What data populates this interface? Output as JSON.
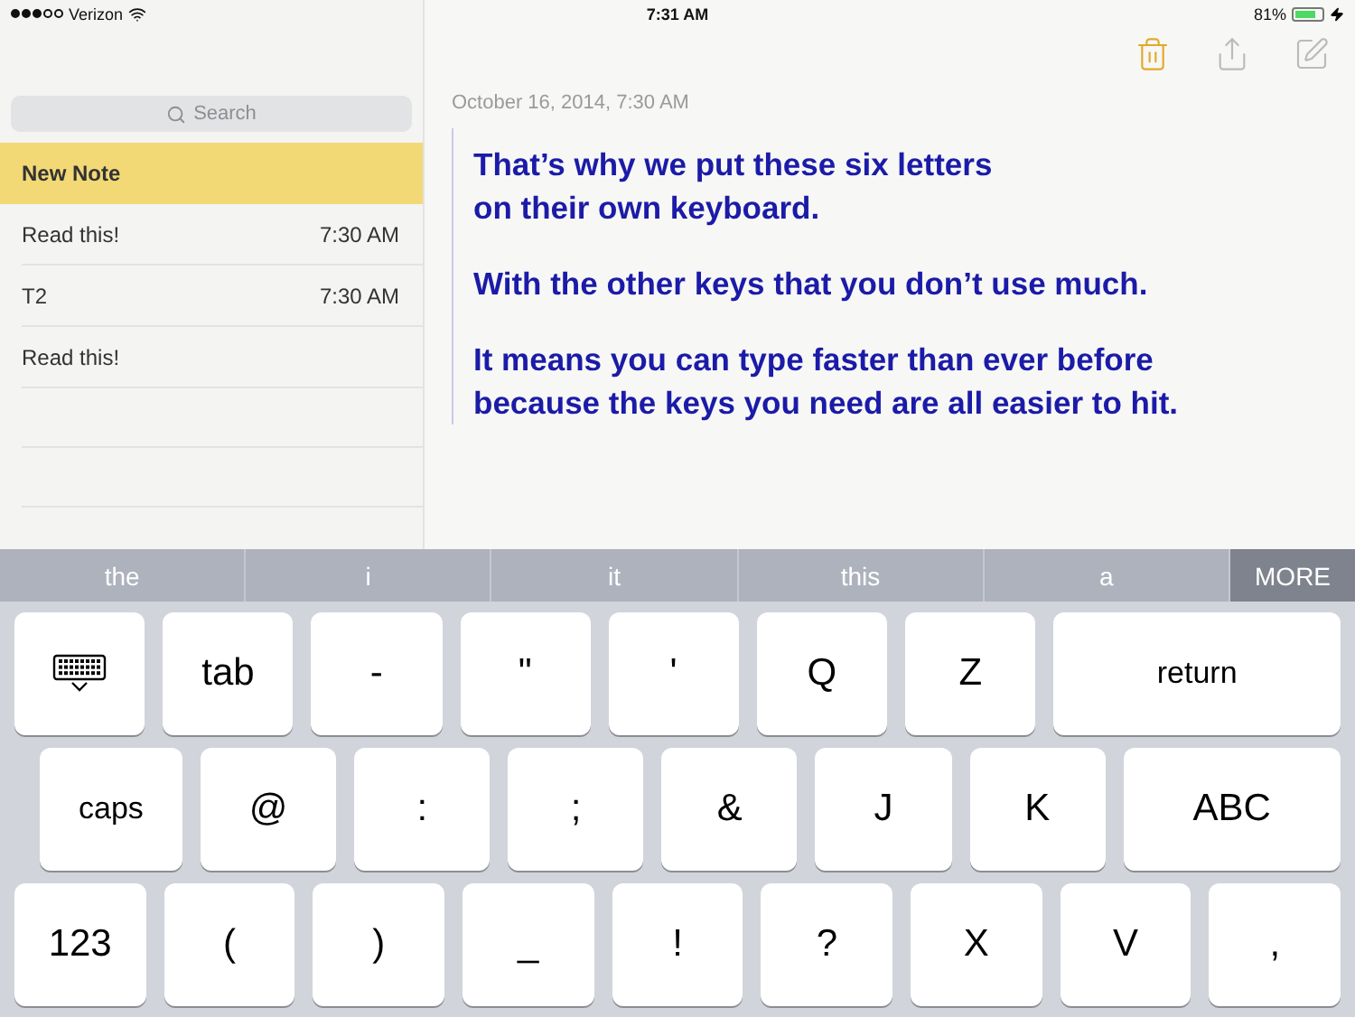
{
  "status_bar": {
    "carrier": "Verizon",
    "time": "7:31 AM",
    "battery": "81%"
  },
  "sidebar": {
    "search": {
      "placeholder": "Search"
    },
    "notes": [
      {
        "title": "New Note",
        "selected": true
      },
      {
        "title": "Read this!",
        "time": "7:30 AM",
        "selected": false
      },
      {
        "title": "T2",
        "time": "7:30 AM",
        "selected": false
      },
      {
        "title": "Read this!",
        "selected": false
      }
    ]
  },
  "note": {
    "date": "October 16, 2014, 7:30 AM",
    "paragraphs": [
      "That’s why we put these six letters\non their own keyboard.",
      "With the other keys that you don’t use much.",
      "It means you can type faster than ever before\nbecause the keys you need are all easier to hit."
    ]
  },
  "suggestions": [
    {
      "label": "the",
      "kind": "word"
    },
    {
      "label": "i",
      "kind": "word"
    },
    {
      "label": "it",
      "kind": "word"
    },
    {
      "label": "this",
      "kind": "word"
    },
    {
      "label": "a",
      "kind": "word"
    },
    {
      "label": "MORE",
      "kind": "more"
    }
  ],
  "keyboard": [
    [
      {
        "kind": "dismiss"
      },
      {
        "label": "tab",
        "kind": "key"
      },
      {
        "label": "-",
        "kind": "key"
      },
      {
        "label": "\"",
        "kind": "key"
      },
      {
        "label": "'",
        "kind": "key"
      },
      {
        "label": "Q",
        "kind": "key"
      },
      {
        "label": "Z",
        "kind": "key"
      },
      {
        "label": "return",
        "kind": "return"
      }
    ],
    [
      {
        "label": "caps",
        "kind": "caps"
      },
      {
        "label": "@",
        "kind": "key"
      },
      {
        "label": ":",
        "kind": "key"
      },
      {
        "label": ";",
        "kind": "key"
      },
      {
        "label": "&",
        "kind": "key"
      },
      {
        "label": "J",
        "kind": "key"
      },
      {
        "label": "K",
        "kind": "key"
      },
      {
        "label": "ABC",
        "kind": "abc"
      }
    ],
    [
      {
        "label": "123",
        "kind": "key"
      },
      {
        "label": "(",
        "kind": "key"
      },
      {
        "label": ")",
        "kind": "key"
      },
      {
        "label": "_",
        "kind": "key"
      },
      {
        "label": "!",
        "kind": "key"
      },
      {
        "label": "?",
        "kind": "key"
      },
      {
        "label": "X",
        "kind": "key"
      },
      {
        "label": "V",
        "kind": "key"
      },
      {
        "label": ",",
        "kind": "key"
      }
    ]
  ]
}
